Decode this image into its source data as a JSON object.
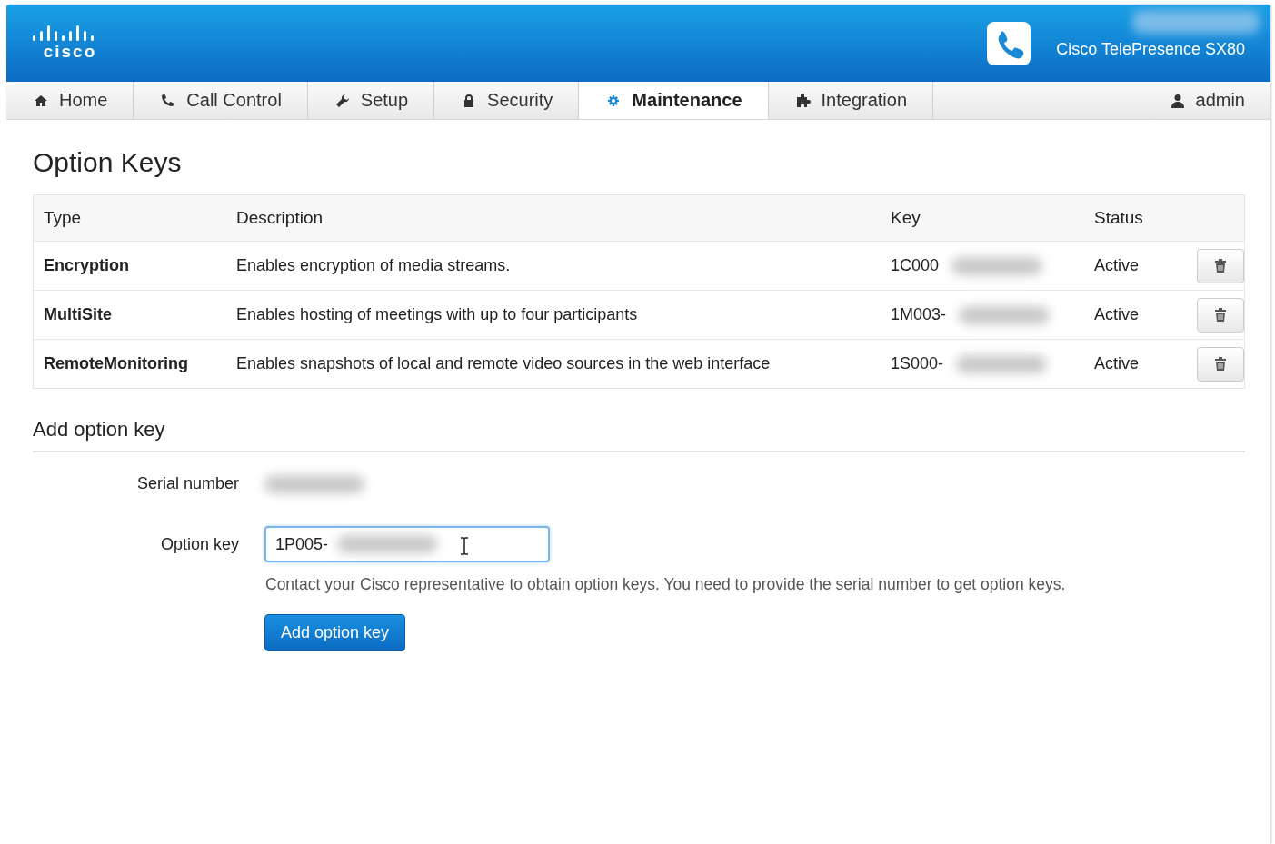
{
  "header": {
    "logo_text": "cisco",
    "product": "Cisco TelePresence SX80"
  },
  "nav": {
    "tabs": [
      {
        "label": "Home",
        "selected": false
      },
      {
        "label": "Call Control",
        "selected": false
      },
      {
        "label": "Setup",
        "selected": false
      },
      {
        "label": "Security",
        "selected": false
      },
      {
        "label": "Maintenance",
        "selected": true
      },
      {
        "label": "Integration",
        "selected": false
      }
    ],
    "user": "admin"
  },
  "page_title": "Option Keys",
  "table": {
    "columns": [
      "Type",
      "Description",
      "Key",
      "Status"
    ],
    "rows": [
      {
        "type": "Encryption",
        "description": "Enables encryption of media streams.",
        "key": "1C000",
        "status": "Active"
      },
      {
        "type": "MultiSite",
        "description": "Enables hosting of meetings with up to four participants",
        "key": "1M003-",
        "status": "Active"
      },
      {
        "type": "RemoteMonitoring",
        "description": "Enables snapshots of local and remote video sources in the web interface",
        "key": "1S000-",
        "status": "Active"
      }
    ]
  },
  "add_section": {
    "title": "Add option key",
    "serial_label": "Serial number",
    "option_label": "Option key",
    "option_value": "1P005-",
    "help": "Contact your Cisco representative to obtain option keys. You need to provide the serial number to get option keys.",
    "button": "Add option key"
  }
}
